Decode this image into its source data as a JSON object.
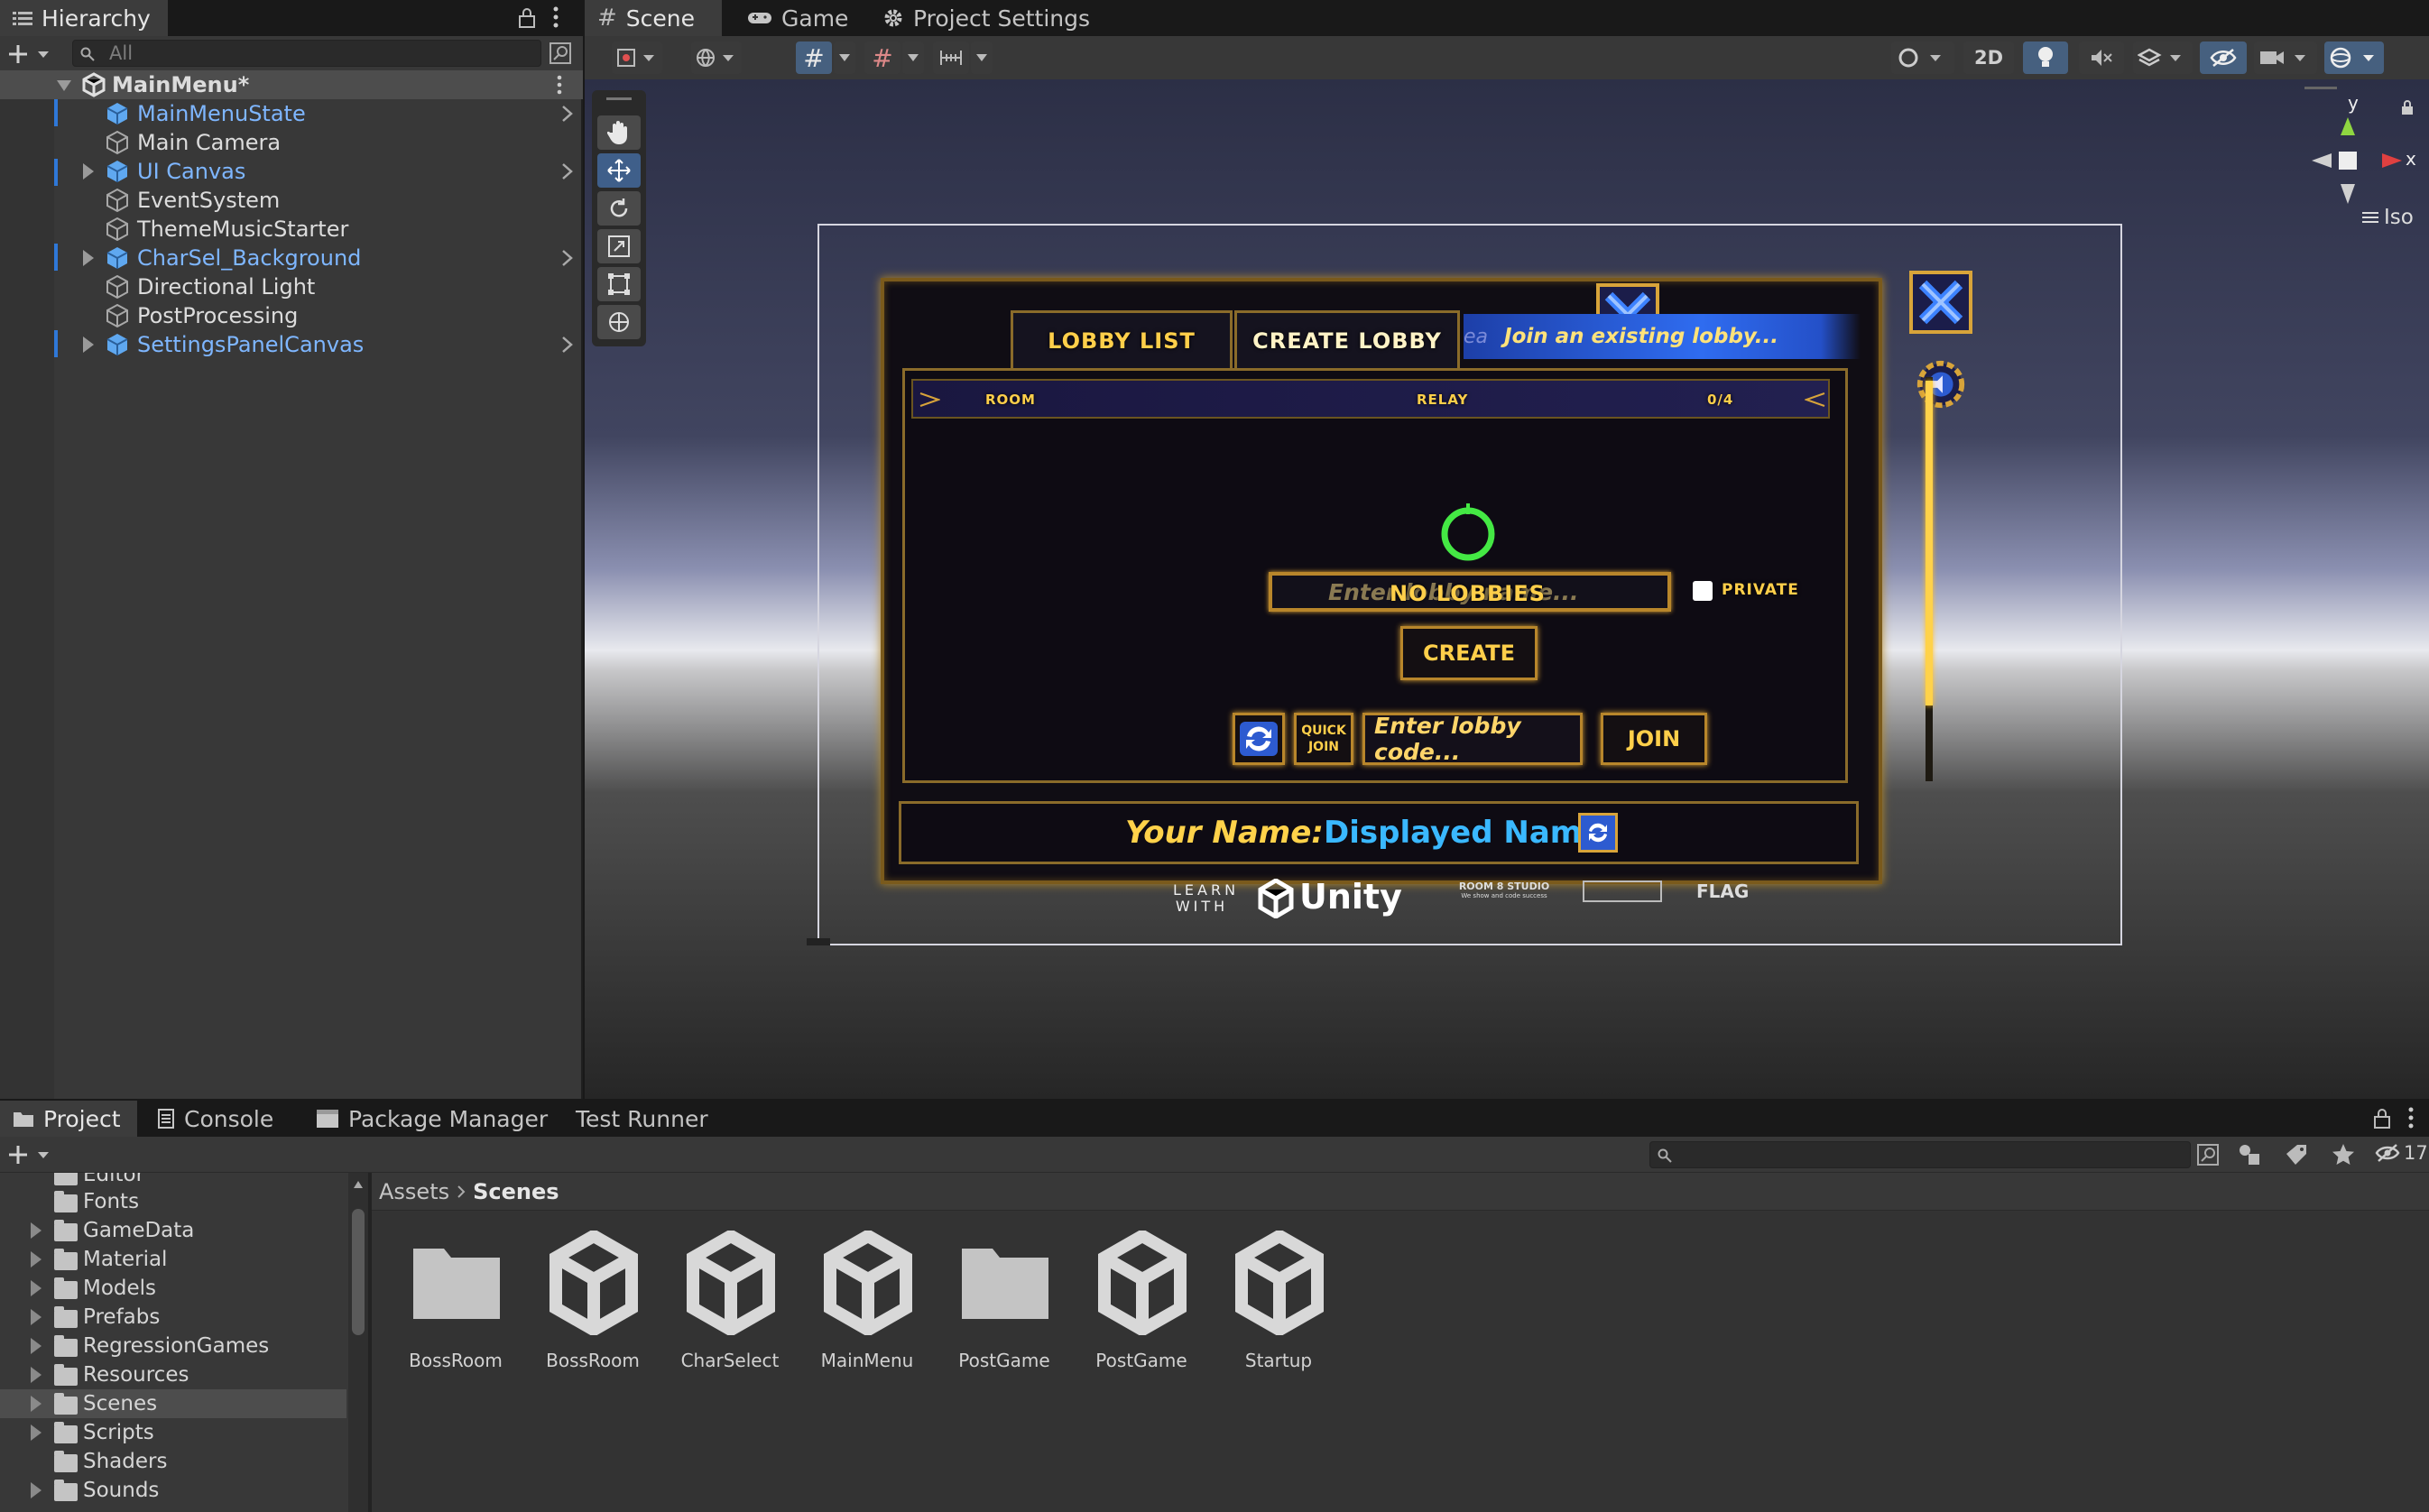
{
  "hierarchy": {
    "tab_label": "Hierarchy",
    "search_placeholder": "All",
    "scene_name": "MainMenu*",
    "items": [
      {
        "label": "MainMenuState",
        "prefab": true
      },
      {
        "label": "Main Camera",
        "prefab": false
      },
      {
        "label": "UI Canvas",
        "prefab": true
      },
      {
        "label": "EventSystem",
        "prefab": false
      },
      {
        "label": "ThemeMusicStarter",
        "prefab": false
      },
      {
        "label": "CharSel_Background",
        "prefab": true
      },
      {
        "label": "Directional Light",
        "prefab": false
      },
      {
        "label": "PostProcessing",
        "prefab": false
      },
      {
        "label": "SettingsPanelCanvas",
        "prefab": true
      }
    ]
  },
  "scene_tabs": {
    "scene": "Scene",
    "game": "Game",
    "project_settings": "Project Settings"
  },
  "scene_toolbar": {
    "mode_2d": "2D",
    "gizmo_iso": "Iso",
    "gizmo_axes": {
      "y": "y",
      "x": "x"
    }
  },
  "game_ui": {
    "tab_lobby_list": "LOBBY LIST",
    "tab_create_lobby": "CREATE LOBBY",
    "banner_prefix": "ea",
    "banner_text": "Join an existing lobby...",
    "col_room": "ROOM",
    "col_relay": "RELAY",
    "col_count": "0/4",
    "lobby_name_placeholder": "Enter lobby name...",
    "no_lobbies": "NO LOBBIES",
    "private_label": "PRIVATE",
    "create_button": "CREATE",
    "quick_join_line1": "QUICK",
    "quick_join_line2": "JOIN",
    "lobby_code_placeholder": "Enter lobby code...",
    "join_button": "JOIN",
    "your_name_label": "Your Name:",
    "displayed_name": "Displayed Name",
    "footer_learn": "LEARN",
    "footer_with": "WITH",
    "footer_unity": "Unity",
    "footer_studio": "ROOM 8 STUDIO",
    "footer_studio_sub": "We show and code success",
    "footer_flag": "FLAG"
  },
  "bottom_tabs": {
    "project": "Project",
    "console": "Console",
    "package_manager": "Package Manager",
    "test_runner": "Test Runner",
    "hidden_count": "17"
  },
  "project_tree": {
    "partial_top": "Editor",
    "folders": [
      {
        "label": "Fonts",
        "expandable": false
      },
      {
        "label": "GameData",
        "expandable": true
      },
      {
        "label": "Material",
        "expandable": true
      },
      {
        "label": "Models",
        "expandable": true
      },
      {
        "label": "Prefabs",
        "expandable": true
      },
      {
        "label": "RegressionGames",
        "expandable": true
      },
      {
        "label": "Resources",
        "expandable": true
      },
      {
        "label": "Scenes",
        "expandable": true,
        "selected": true
      },
      {
        "label": "Scripts",
        "expandable": true
      },
      {
        "label": "Shaders",
        "expandable": false
      },
      {
        "label": "Sounds",
        "expandable": true
      }
    ]
  },
  "breadcrumb": {
    "root": "Assets",
    "current": "Scenes"
  },
  "assets": [
    {
      "name": "BossRoom",
      "type": "folder"
    },
    {
      "name": "BossRoom",
      "type": "scene"
    },
    {
      "name": "CharSelect",
      "type": "scene"
    },
    {
      "name": "MainMenu",
      "type": "scene"
    },
    {
      "name": "PostGame",
      "type": "folder"
    },
    {
      "name": "PostGame",
      "type": "scene"
    },
    {
      "name": "Startup",
      "type": "scene"
    }
  ],
  "colors": {
    "panel_bg": "#383838",
    "tab_bar": "#191919",
    "prefab_blue": "#7eb6ff",
    "gold": "#ffcf4a",
    "name_cyan": "#3ab8ff",
    "selection": "#4d4d4d"
  }
}
